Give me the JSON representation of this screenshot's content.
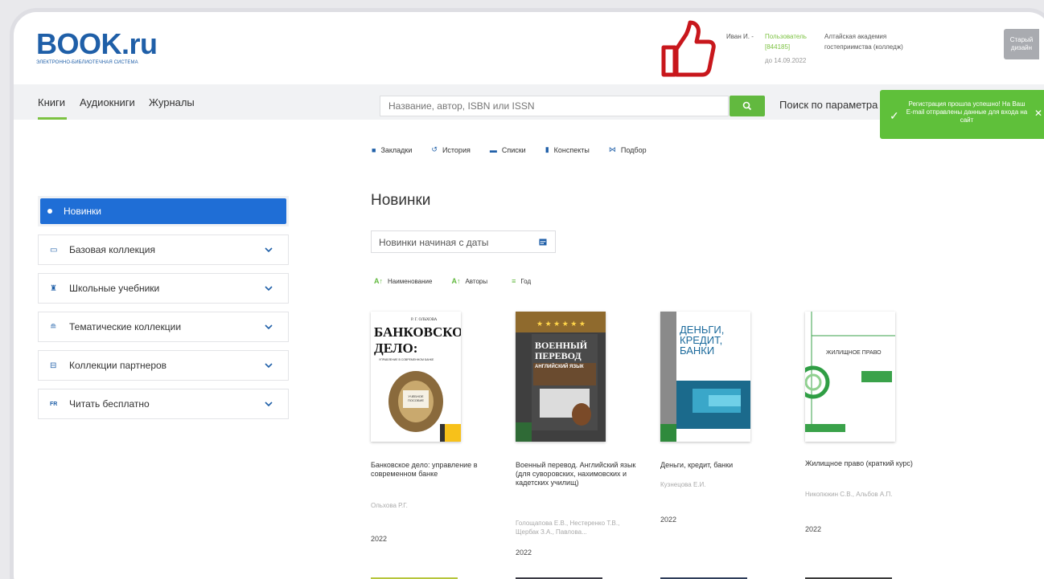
{
  "header": {
    "logo": "BOOK.ru",
    "logo_subtitle": "ЭЛЕКТРОННО-БИБЛИОТЕЧНАЯ СИСТЕМА",
    "user_name": "Иван И. -",
    "user_role": "Пользователь",
    "user_id": "[844185]",
    "valid_until": "до 14.09.2022",
    "organization": "Алтайская академия гостеприимства (колледж)",
    "old_design": "Старый дизайн"
  },
  "nav": {
    "tabs": [
      "Книги",
      "Аудиокниги",
      "Журналы"
    ],
    "search_placeholder": "Название, автор, ISBN или ISSN",
    "param_search": "Поиск по параметра"
  },
  "toast": {
    "message": "Регистрация прошла успешно! На Ваш E-mail отправлены данные для входа на сайт"
  },
  "subtools": [
    "Закладки",
    "История",
    "Списки",
    "Конспекты",
    "Подбор"
  ],
  "sidebar": {
    "items": [
      {
        "label": "Новинки"
      },
      {
        "label": "Базовая коллекция"
      },
      {
        "label": "Школьные учебники"
      },
      {
        "label": "Тематические коллекции"
      },
      {
        "label": "Коллекции партнеров"
      },
      {
        "label": "Читать бесплатно"
      }
    ]
  },
  "main": {
    "title": "Новинки",
    "date_placeholder": "Новинки начиная с даты",
    "sorts": [
      "Наименование",
      "Авторы",
      "Год"
    ]
  },
  "books": [
    {
      "title": "Банковское дело: управление в современном банке",
      "author": "Ольхова Р.Г.",
      "year": "2022",
      "cover_top": "Р. Г. ОЛЬХОВА",
      "cover_title": "БАНКОВСКОЕ ДЕЛО:",
      "cover_sub": "УПРАВЛЕНИЕ В СОВРЕМЕННОМ БАНКЕ",
      "cover_badge": "УЧЕБНОЕ ПОСОБИЕ"
    },
    {
      "title": "Военный перевод. Английский язык (для суворовских, нахимовских и кадетских училищ)",
      "author": "Голощапова Е.В., Нестеренко Т.В., Щербак З.А., Павлова...",
      "year": "2022",
      "cover_title": "ВОЕННЫЙ ПЕРЕВОД",
      "cover_sub": "АНГЛИЙСКИЙ ЯЗЫК"
    },
    {
      "title": "Деньги, кредит, банки",
      "author": "Кузнецова Е.И.",
      "year": "2022",
      "cover_title": "ДЕНЬГИ, КРЕДИТ, БАНКИ"
    },
    {
      "title": "Жилищное право (краткий курс)",
      "author": "Никопюкин С.В., Альбов А.П.",
      "year": "2022",
      "cover_title": "ЖИЛИЩНОЕ ПРАВО"
    }
  ],
  "colors": {
    "brand_blue": "#1f5fa8",
    "accent_green": "#62b93f",
    "active_blue": "#1f6ed6",
    "thumb_red": "#c8171c"
  }
}
